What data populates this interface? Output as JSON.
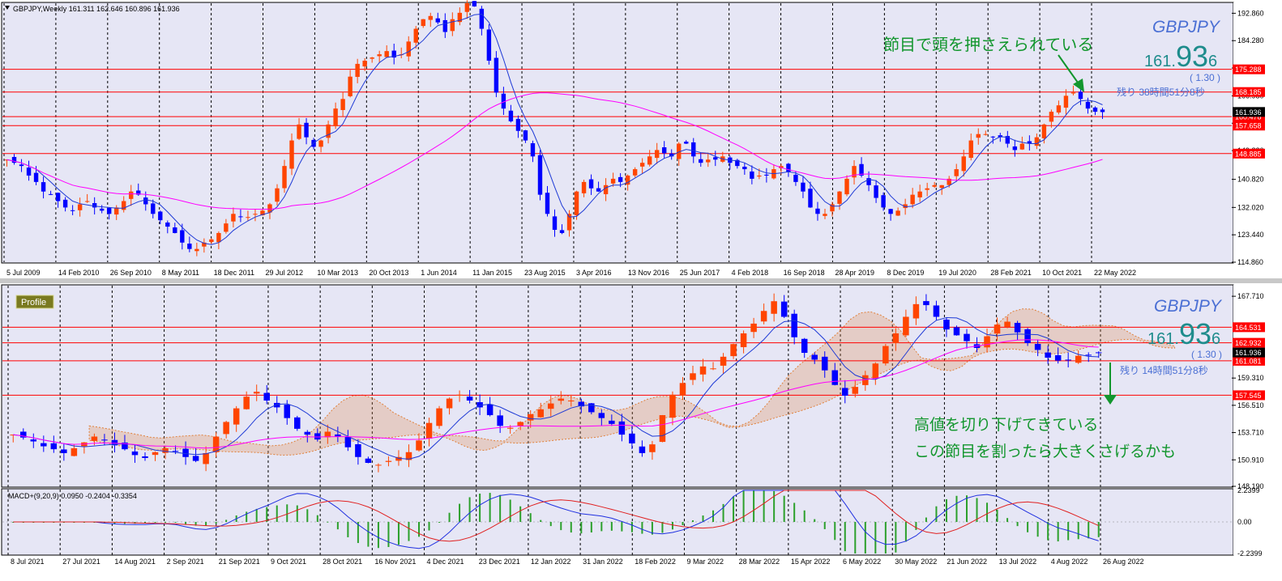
{
  "panels": {
    "top": {
      "header": "GBPJPY,Weekly  161.311 162.646 160.896 161.936",
      "symbol": "GBPJPY",
      "price_main": "161.",
      "price_big": "93",
      "price_small": "6",
      "change": "( 1.30 )",
      "remaining": "残り 38時間51分8秒",
      "annotation": "節目で頭を押さえられている"
    },
    "bottom": {
      "profile_label": "Profile",
      "symbol": "GBPJPY",
      "price_main": "161.",
      "price_big": "93",
      "price_small": "6",
      "change": "( 1.30 )",
      "remaining": "残り 14時間51分8秒",
      "annotation_line1": "高値を切り下げてきている",
      "annotation_line2": "この節目を割ったら大きくさげるかも",
      "macd_label": "MACD+(9,20,9) 0.0950 -0.2404 -0.3354"
    }
  },
  "colors": {
    "background": "#e6e6f5",
    "up_candle": "#ff4500",
    "down_candle": "#0000ff",
    "ma_short": "#1e3ad6",
    "ma_long": "#ff00ff",
    "level_line": "#ff0000",
    "annotation": "#12962d",
    "symbol": "#4a6fd4",
    "price": "#1e8c8c",
    "cloud": "#e0803a",
    "macd_line": "#2030e0",
    "signal_line": "#e02020",
    "histogram": "#2ca02c"
  },
  "chart_data": [
    {
      "type": "candlestick",
      "title": "GBPJPY,Weekly",
      "ohlc_last": {
        "open": 161.311,
        "high": 162.646,
        "low": 160.896,
        "close": 161.936
      },
      "x_ticks": [
        "5 Jul 2009",
        "14 Feb 2010",
        "26 Sep 2010",
        "8 May 2011",
        "18 Dec 2011",
        "29 Jul 2012",
        "10 Mar 2013",
        "20 Oct 2013",
        "1 Jun 2014",
        "11 Jan 2015",
        "23 Aug 2015",
        "3 Apr 2016",
        "13 Nov 2016",
        "25 Jun 2017",
        "4 Feb 2018",
        "16 Sep 2018",
        "28 Apr 2019",
        "8 Dec 2019",
        "19 Jul 2020",
        "28 Feb 2021",
        "10 Oct 2021",
        "22 May 2022"
      ],
      "y_ticks": [
        "192.860",
        "184.280",
        "175.700",
        "166.980",
        "158.400",
        "149.820",
        "140.820",
        "132.020",
        "123.440",
        "114.860"
      ],
      "ylim": [
        114.86,
        196
      ],
      "levels": [
        "175.288",
        "168.185",
        "160.478",
        "157.658",
        "148.885"
      ],
      "price_tag": "161.936",
      "closes": [
        147,
        146,
        145,
        142,
        140,
        137,
        136,
        134,
        132,
        131,
        133,
        134,
        132,
        131,
        130,
        132,
        134,
        137,
        136,
        133,
        130,
        128,
        126,
        124,
        121,
        119,
        119,
        121,
        122,
        124,
        127,
        130,
        129,
        129,
        130,
        131,
        133,
        138,
        145,
        153,
        158,
        154,
        151,
        153,
        158,
        163,
        166,
        173,
        177,
        178,
        179,
        180,
        181,
        179,
        180,
        184,
        188,
        191,
        192,
        190,
        187,
        191,
        193,
        196,
        195,
        188,
        178,
        168,
        163,
        159,
        156,
        153,
        148,
        136,
        130,
        125,
        124,
        130,
        137,
        140,
        138,
        137,
        139,
        141,
        140,
        142,
        144,
        146,
        148,
        150,
        149,
        148,
        152,
        152,
        148,
        146,
        147,
        147,
        148,
        146,
        145,
        144,
        141,
        142,
        142,
        144,
        145,
        143,
        140,
        137,
        132,
        130,
        130,
        133,
        137,
        141,
        145,
        142,
        139,
        135,
        132,
        130,
        131,
        133,
        136,
        137,
        138,
        139,
        139,
        141,
        144,
        148,
        153,
        155,
        155,
        154,
        154,
        152,
        150,
        152,
        152,
        154,
        158,
        162,
        164,
        167,
        168,
        166,
        163,
        162,
        161.9
      ]
    },
    {
      "type": "candlestick",
      "x_ticks": [
        "8 Jul 2021",
        "27 Jul 2021",
        "14 Aug 2021",
        "2 Sep 2021",
        "21 Sep 2021",
        "9 Oct 2021",
        "28 Oct 2021",
        "16 Nov 2021",
        "4 Dec 2021",
        "23 Dec 2021",
        "12 Jan 2022",
        "31 Jan 2022",
        "18 Feb 2022",
        "9 Mar 2022",
        "28 Mar 2022",
        "15 Apr 2022",
        "6 May 2022",
        "30 May 2022",
        "21 Jun 2022",
        "13 Jul 2022",
        "4 Aug 2022",
        "26 Aug 2022"
      ],
      "y_ticks": [
        "167.710",
        "164.531",
        "162.932",
        "161.936",
        "161.081",
        "159.310",
        "157.545",
        "156.510",
        "153.710",
        "150.910",
        "148.190"
      ],
      "ylim": [
        148.19,
        168.8
      ],
      "levels": [
        "164.531",
        "162.932",
        "161.081",
        "157.545"
      ],
      "price_tag": "161.936",
      "closes": [
        153.5,
        153.2,
        152.8,
        152.3,
        152.0,
        151.6,
        152.1,
        152.7,
        153.3,
        152.9,
        152.4,
        152.0,
        151.4,
        151.1,
        151.7,
        152.1,
        151.8,
        151.2,
        150.8,
        151.6,
        153.3,
        154.8,
        156.2,
        157.4,
        157.9,
        157.0,
        156.3,
        155.2,
        154.1,
        153.5,
        153.0,
        153.8,
        153.3,
        152.2,
        151.2,
        150.6,
        150.4,
        150.8,
        151.2,
        151.7,
        152.9,
        154.7,
        156.2,
        157.2,
        157.6,
        157.0,
        156.3,
        155.5,
        154.4,
        154.2,
        154.8,
        155.6,
        156.1,
        156.7,
        157.2,
        157.0,
        156.4,
        155.8,
        155.2,
        154.6,
        153.5,
        152.6,
        151.6,
        152.5,
        155.5,
        157.6,
        158.8,
        159.8,
        160.5,
        160.3,
        161.5,
        162.8,
        163.9,
        164.9,
        166.2,
        167.2,
        165.6,
        163.5,
        161.9,
        161.2,
        160.1,
        158.6,
        157.5,
        158.4,
        159.6,
        160.8,
        162.6,
        163.9,
        165.6,
        166.9,
        166.8,
        165.6,
        164.3,
        163.7,
        163.1,
        162.4,
        163.6,
        164.8,
        165.1,
        164.0,
        162.9,
        162.2,
        161.4,
        161.1,
        161.2,
        161.6,
        161.7,
        161.9
      ]
    },
    {
      "type": "macd",
      "title": "MACD+(9,20,9)",
      "values": {
        "macd": 0.095,
        "signal": -0.2404,
        "histogram": -0.3354
      },
      "y_ticks": [
        "2.2399",
        "0.00",
        "-2.2399"
      ],
      "ylim": [
        -2.2399,
        2.2399
      ]
    }
  ]
}
